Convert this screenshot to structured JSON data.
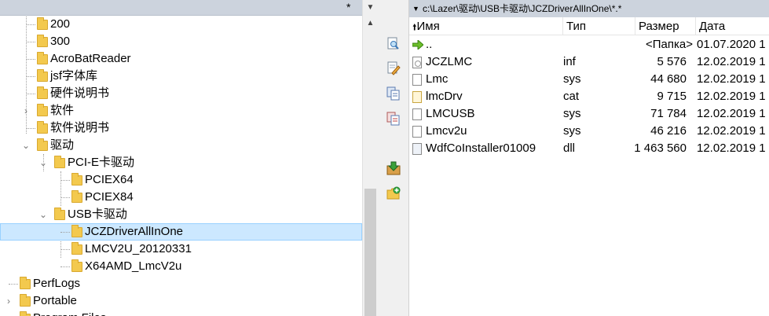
{
  "left": {
    "header": {
      "filter": "*"
    },
    "tree": [
      {
        "label": "200"
      },
      {
        "label": "300"
      },
      {
        "label": "AcroBatReader"
      },
      {
        "label": "jsf字体库"
      },
      {
        "label": "硬件说明书"
      },
      {
        "label": "软件"
      },
      {
        "label": "软件说明书"
      },
      {
        "label": "驱动"
      },
      {
        "label": "PCI-E卡驱动"
      },
      {
        "label": "PCIEX64"
      },
      {
        "label": "PCIEX84"
      },
      {
        "label": "USB卡驱动"
      },
      {
        "label": "JCZDriverAllInOne"
      },
      {
        "label": "LMCV2U_20120331"
      },
      {
        "label": "X64AMD_LmcV2u"
      },
      {
        "label": "PerfLogs"
      },
      {
        "label": "Portable"
      },
      {
        "label": "Program Files"
      }
    ]
  },
  "toolbar": {
    "icons": [
      "view-icon",
      "edit-icon",
      "copy-icon",
      "move-icon",
      "archive-icon",
      "new-folder-icon"
    ]
  },
  "right": {
    "path": "c:\\Lazer\\驱动\\USB卡驱动\\JCZDriverAllInOne\\*.*",
    "columns": {
      "name": "Имя",
      "type": "Тип",
      "size": "Размер",
      "date": "Дата"
    },
    "files": [
      {
        "name": "..",
        "type": "",
        "size": "<Папка>",
        "date": "01.07.2020 1",
        "icon": "up"
      },
      {
        "name": "JCZLMC",
        "type": "inf",
        "size": "5 576",
        "date": "12.02.2019 1",
        "icon": "inf"
      },
      {
        "name": "Lmc",
        "type": "sys",
        "size": "44 680",
        "date": "12.02.2019 1",
        "icon": "sys"
      },
      {
        "name": "lmcDrv",
        "type": "cat",
        "size": "9 715",
        "date": "12.02.2019 1",
        "icon": "cat"
      },
      {
        "name": "LMCUSB",
        "type": "sys",
        "size": "71 784",
        "date": "12.02.2019 1",
        "icon": "sys"
      },
      {
        "name": "Lmcv2u",
        "type": "sys",
        "size": "46 216",
        "date": "12.02.2019 1",
        "icon": "sys"
      },
      {
        "name": "WdfCoInstaller01009",
        "type": "dll",
        "size": "1 463 560",
        "date": "12.02.2019 1",
        "icon": "dll"
      }
    ]
  }
}
